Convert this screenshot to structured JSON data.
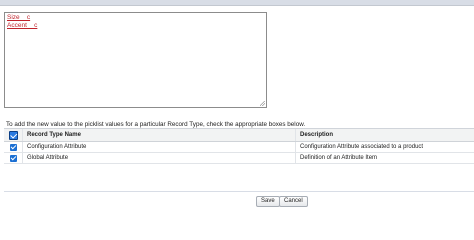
{
  "textarea": {
    "lines": [
      "Size__c",
      "Accent__c"
    ]
  },
  "help_text": "To add the new value to the picklist values for a particular Record Type, check the appropriate boxes below.",
  "table": {
    "columns": [
      "Record Type Name",
      "Description"
    ],
    "rows": [
      {
        "name": "Configuration Attribute",
        "description": "Configuration Attribute associated to a product",
        "checked": true
      },
      {
        "name": "Global Attribute",
        "description": "Definition of an Attribute Item",
        "checked": true
      }
    ],
    "select_all_checked": true
  },
  "buttons": {
    "save": "Save",
    "cancel": "Cancel"
  },
  "colors": {
    "checkbox": "#1b6fd3",
    "textarea_text": "#c0232c"
  },
  "icons": {
    "select_all": "checkbox-checked-icon",
    "row_check": "checkbox-checked-icon",
    "resize": "resize-handle-icon"
  }
}
